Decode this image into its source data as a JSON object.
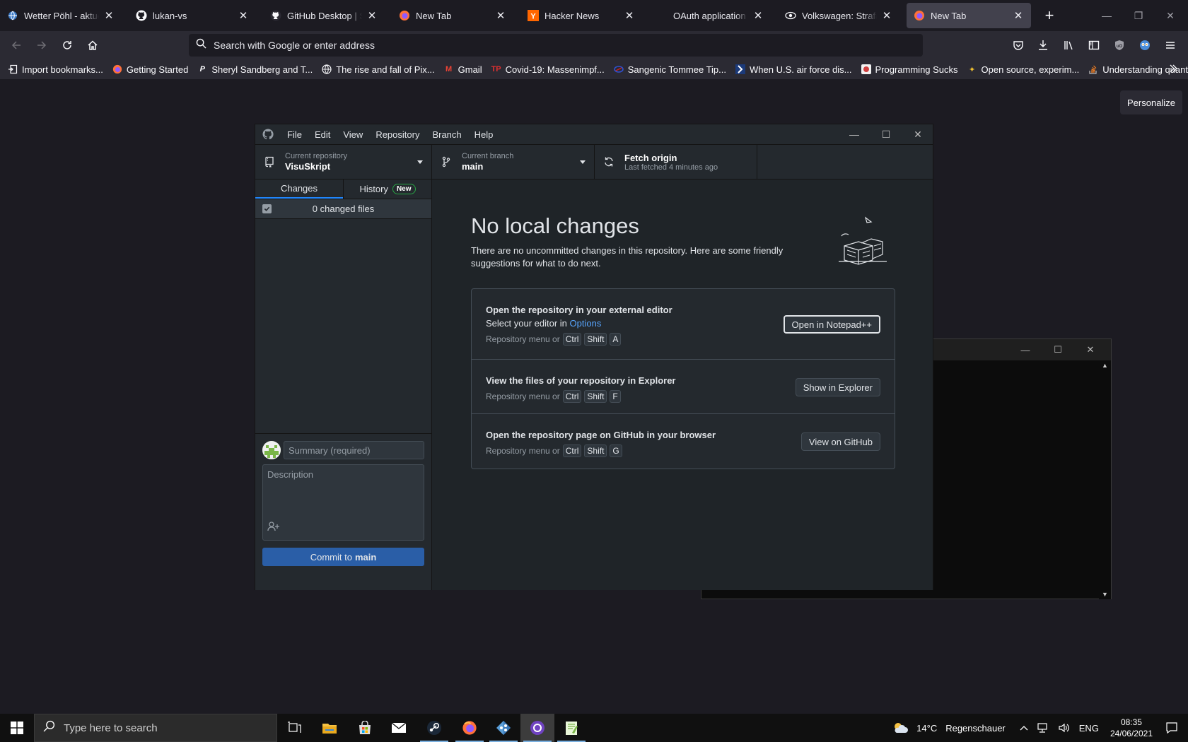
{
  "browser": {
    "tabs": [
      {
        "title": "Wetter Pöhl - aktuelle Wettervorhersage",
        "icon": "globe-icon",
        "active": false
      },
      {
        "title": "lukan-vs",
        "icon": "github-icon",
        "active": false
      },
      {
        "title": "GitHub Desktop | Simple collaboration",
        "icon": "github-icon",
        "active": false
      },
      {
        "title": "New Tab",
        "icon": "firefox-icon",
        "active": false
      },
      {
        "title": "Hacker News",
        "icon": "hackernews-icon",
        "active": false
      },
      {
        "title": "OAuth application authorized",
        "icon": "blank-icon",
        "active": false
      },
      {
        "title": "Volkswagen: Strafantrag",
        "icon": "eye-icon",
        "active": false
      },
      {
        "title": "New Tab",
        "icon": "firefox-icon",
        "active": true
      }
    ],
    "urlbar_placeholder": "Search with Google or enter address",
    "bookmarks": [
      {
        "label": "Import bookmarks...",
        "icon": "import-icon"
      },
      {
        "label": "Getting Started",
        "icon": "firefox-icon"
      },
      {
        "label": "Sheryl Sandberg and T...",
        "icon": "p-icon"
      },
      {
        "label": "The rise and fall of Pix...",
        "icon": "globe-icon"
      },
      {
        "label": "Gmail",
        "icon": "gmail-icon"
      },
      {
        "label": "Covid-19: Massenimpf...",
        "icon": "tp-icon"
      },
      {
        "label": "Sangenic Tommee Tip...",
        "icon": "tommee-icon"
      },
      {
        "label": "When U.S. air force dis...",
        "icon": "chevron-logo-icon"
      },
      {
        "label": "Programming Sucks",
        "icon": "ps-icon"
      },
      {
        "label": "Open source, experim...",
        "icon": "sparkle-icon"
      },
      {
        "label": "Understanding quantu...",
        "icon": "stackoverflow-icon"
      }
    ],
    "personalize_label": "Personalize"
  },
  "github_desktop": {
    "menu": [
      "File",
      "Edit",
      "View",
      "Repository",
      "Branch",
      "Help"
    ],
    "toolbar": {
      "repo_caption": "Current repository",
      "repo_name": "VisuSkript",
      "branch_caption": "Current branch",
      "branch_name": "main",
      "fetch_title": "Fetch origin",
      "fetch_sub": "Last fetched 4 minutes ago"
    },
    "sidebar": {
      "tab_changes": "Changes",
      "tab_history": "History",
      "history_badge": "New",
      "changed_files": "0 changed files",
      "summary_placeholder": "Summary (required)",
      "description_placeholder": "Description",
      "commit_prefix": "Commit to",
      "commit_branch": "main"
    },
    "main": {
      "title": "No local changes",
      "description": "There are no uncommitted changes in this repository. Here are some friendly suggestions for what to do next.",
      "suggestions": [
        {
          "title": "Open the repository in your external editor",
          "sub_prefix": "Select your editor in ",
          "sub_link": "Options",
          "keys_prefix": "Repository menu or",
          "keys": [
            "Ctrl",
            "Shift",
            "A"
          ],
          "button": "Open in Notepad++"
        },
        {
          "title": "View the files of your repository in Explorer",
          "keys_prefix": "Repository menu or",
          "keys": [
            "Ctrl",
            "Shift",
            "F"
          ],
          "button": "Show in Explorer"
        },
        {
          "title": "Open the repository page on GitHub in your browser",
          "keys_prefix": "Repository menu or",
          "keys": [
            "Ctrl",
            "Shift",
            "G"
          ],
          "button": "View on GitHub"
        }
      ]
    }
  },
  "taskbar": {
    "search_placeholder": "Type here to search",
    "weather_temp": "14°C",
    "weather_text": "Regenschauer",
    "language": "ENG",
    "time": "08:35",
    "date": "24/06/2021"
  }
}
